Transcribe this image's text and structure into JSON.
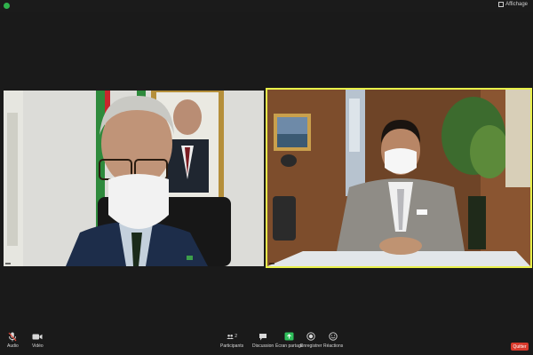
{
  "top_bar": {
    "view_label": "Affichage"
  },
  "participants": [
    {
      "name": ""
    },
    {
      "name": ""
    }
  ],
  "toolbar": {
    "audio_label": "Audio",
    "video_label": "Vidéo",
    "participants_label": "Participants",
    "participants_count": "2",
    "chat_label": "Discussion",
    "share_label": "Écran partagé",
    "record_label": "Enregistrer",
    "reactions_label": "Réactions",
    "end_label": "Quitter"
  }
}
